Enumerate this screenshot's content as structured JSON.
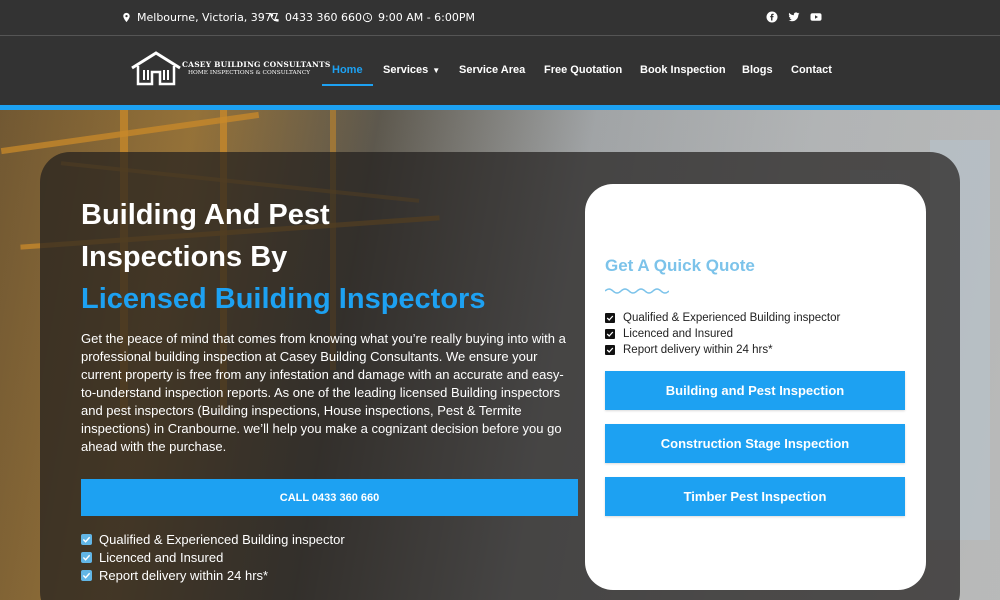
{
  "topbar": {
    "location": "Melbourne, Victoria, 3977",
    "phone": "0433 360 660",
    "hours": "9:00 AM - 6:00PM",
    "social": [
      "facebook-icon",
      "twitter-icon",
      "youtube-icon"
    ]
  },
  "logo": {
    "brand_line1": "CASEY BUILDING CONSULTANTS",
    "brand_line2": "HOME INSPECTIONS & CONSULTANCY"
  },
  "nav": {
    "home": "Home",
    "services": "Services",
    "service_area": "Service Area",
    "free_quotation": "Free Quotation",
    "book_inspection": "Book Inspection",
    "blogs": "Blogs",
    "contact": "Contact",
    "active": "Home"
  },
  "hero": {
    "title_line1": "Building And Pest",
    "title_line2": "Inspections By",
    "title_line3": "Licensed Building Inspectors",
    "paragraph": "Get the peace of mind that comes from knowing what you’re really buying into with a professional building inspection at Casey Building Consultants. We ensure your current property is free from any infestation and damage with an accurate and easy-to-understand inspection reports. As one of the leading licensed Building inspectors and pest inspectors (Building inspections, House inspections, Pest & Termite inspections) in Cranbourne. we’ll help you make a cognizant decision before you go ahead with the purchase.",
    "call_button": "CALL 0433 360 660",
    "checks": [
      "Qualified & Experienced Building inspector",
      "Licenced and Insured",
      "Report delivery within 24 hrs*"
    ]
  },
  "quote_card": {
    "title": "Get A Quick Quote",
    "checks": [
      "Qualified & Experienced Building inspector",
      "Licenced and Insured",
      "Report delivery within 24 hrs*"
    ],
    "buttons": [
      "Building and Pest Inspection",
      "Construction Stage Inspection",
      "Timber Pest Inspection"
    ]
  },
  "colors": {
    "accent": "#1da1f2",
    "header_bg": "#333333",
    "card_title": "#7cc3ea"
  }
}
